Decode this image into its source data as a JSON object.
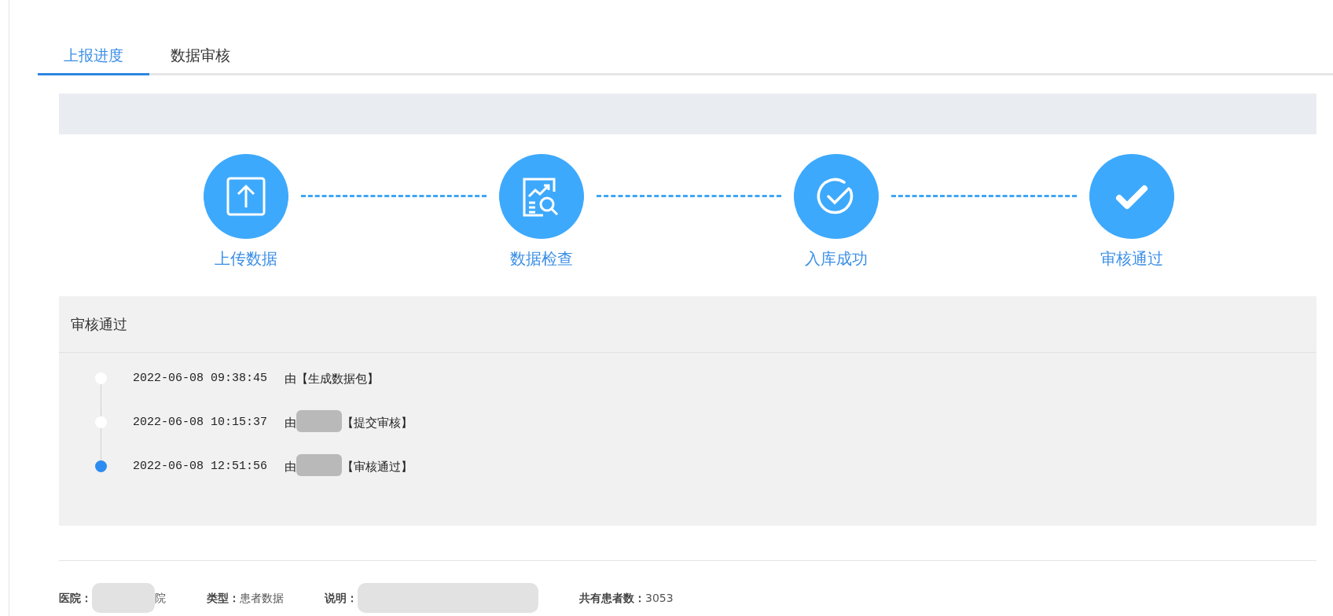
{
  "tabs": [
    {
      "label": "上报进度",
      "selected": true
    },
    {
      "label": "数据审核",
      "selected": false
    }
  ],
  "steps": [
    {
      "label": "上传数据",
      "kind": "upload"
    },
    {
      "label": "数据检查",
      "kind": "inspect"
    },
    {
      "label": "入库成功",
      "kind": "stored"
    },
    {
      "label": "审核通过",
      "kind": "approved"
    }
  ],
  "log": {
    "title": "审核通过",
    "entries": [
      {
        "time": "2022-06-08 09:38:45",
        "by": "由",
        "action": "【生成数据包】",
        "redacted": false,
        "active": false
      },
      {
        "time": "2022-06-08 10:15:37",
        "by": "由",
        "action": "【提交审核】",
        "redacted": true,
        "active": false
      },
      {
        "time": "2022-06-08 12:51:56",
        "by": "由",
        "action": "【审核通过】",
        "redacted": true,
        "active": true
      }
    ]
  },
  "footer": [
    {
      "label": "医院：",
      "value": "院",
      "redacted": true
    },
    {
      "label": "类型：",
      "value": "患者数据",
      "redacted": false
    },
    {
      "label": "说明：",
      "redacted": true
    },
    {
      "label": "共有患者数：",
      "value": "3053",
      "redacted": false
    }
  ]
}
